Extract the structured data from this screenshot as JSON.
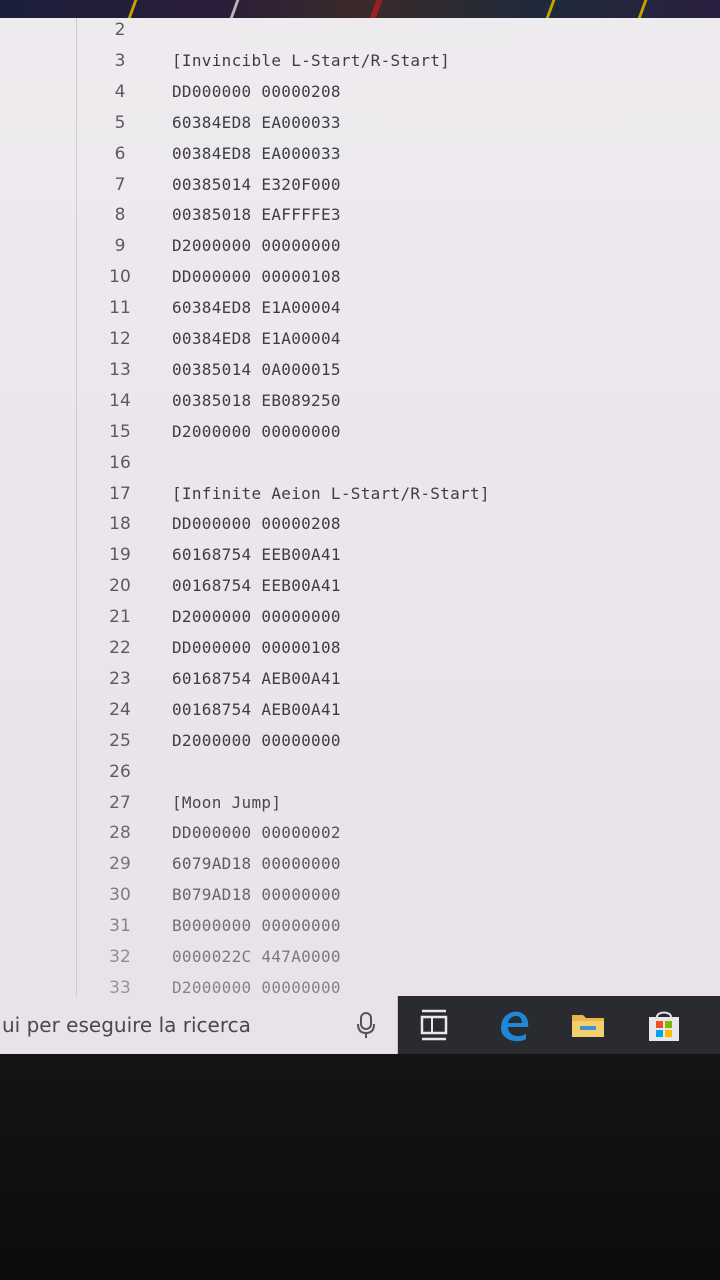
{
  "editor": {
    "lines": [
      {
        "num": "2",
        "text": ""
      },
      {
        "num": "3",
        "text": "[Invincible L-Start/R-Start]"
      },
      {
        "num": "4",
        "text": "DD000000 00000208"
      },
      {
        "num": "5",
        "text": "60384ED8 EA000033"
      },
      {
        "num": "6",
        "text": "00384ED8 EA000033"
      },
      {
        "num": "7",
        "text": "00385014 E320F000"
      },
      {
        "num": "8",
        "text": "00385018 EAFFFFE3"
      },
      {
        "num": "9",
        "text": "D2000000 00000000"
      },
      {
        "num": "10",
        "text": "DD000000 00000108"
      },
      {
        "num": "11",
        "text": "60384ED8 E1A00004"
      },
      {
        "num": "12",
        "text": "00384ED8 E1A00004"
      },
      {
        "num": "13",
        "text": "00385014 0A000015"
      },
      {
        "num": "14",
        "text": "00385018 EB089250"
      },
      {
        "num": "15",
        "text": "D2000000 00000000"
      },
      {
        "num": "16",
        "text": ""
      },
      {
        "num": "17",
        "text": "[Infinite Aeion L-Start/R-Start]"
      },
      {
        "num": "18",
        "text": "DD000000 00000208"
      },
      {
        "num": "19",
        "text": "60168754 EEB00A41"
      },
      {
        "num": "20",
        "text": "00168754 EEB00A41"
      },
      {
        "num": "21",
        "text": "D2000000 00000000"
      },
      {
        "num": "22",
        "text": "DD000000 00000108"
      },
      {
        "num": "23",
        "text": "60168754 AEB00A41"
      },
      {
        "num": "24",
        "text": "00168754 AEB00A41"
      },
      {
        "num": "25",
        "text": "D2000000 00000000"
      },
      {
        "num": "26",
        "text": ""
      },
      {
        "num": "27",
        "text": "[Moon Jump]"
      },
      {
        "num": "28",
        "text": "DD000000 00000002"
      },
      {
        "num": "29",
        "text": "6079AD18 00000000"
      },
      {
        "num": "30",
        "text": "B079AD18 00000000"
      },
      {
        "num": "31",
        "text": "B0000000 00000000"
      },
      {
        "num": "32",
        "text": "0000022C 447A0000"
      },
      {
        "num": "33",
        "text": "D2000000 00000000"
      }
    ]
  },
  "taskbar": {
    "search_placeholder": "ui per eseguire la ricerca",
    "icons": [
      "microphone-icon",
      "task-view-icon",
      "edge-icon",
      "file-explorer-icon",
      "store-icon"
    ]
  },
  "colors": {
    "editor_bg": "#eeebef",
    "code_text": "#3f3d44",
    "line_number": "#5c5a60",
    "taskbar_bg": "#2a2b31",
    "edge_blue": "#1e88d6",
    "folder_yellow": "#e8b64a"
  }
}
